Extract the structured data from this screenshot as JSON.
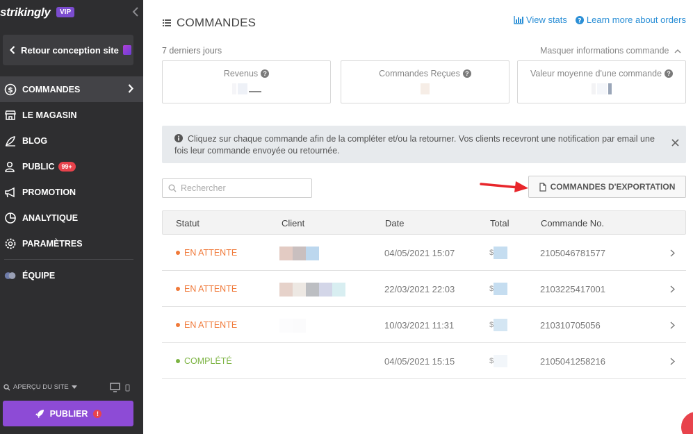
{
  "sidebar": {
    "logo": "strikingly",
    "vip_badge": "VIP",
    "back_label": "Retour conception site",
    "nav": [
      {
        "label": "COMMANDES",
        "icon": "dollar-icon",
        "active": true
      },
      {
        "label": "LE MAGASIN",
        "icon": "store-icon"
      },
      {
        "label": "BLOG",
        "icon": "pen-icon"
      },
      {
        "label": "PUBLIC",
        "icon": "users-icon",
        "badge": "99+"
      },
      {
        "label": "PROMOTION",
        "icon": "megaphone-icon"
      },
      {
        "label": "ANALYTIQUE",
        "icon": "pie-chart-icon"
      },
      {
        "label": "PARAMÈTRES",
        "icon": "gear-icon"
      }
    ],
    "team_label": "ÉQUIPE",
    "preview_label": "APERÇU DU SITE",
    "publish_label": "PUBLIER"
  },
  "header": {
    "title": "COMMANDES",
    "view_stats": "View stats",
    "learn_more": "Learn more about orders"
  },
  "period": "7 derniers jours",
  "hide_info": "Masquer informations commande",
  "stats": [
    {
      "label": "Revenus"
    },
    {
      "label": "Commandes Reçues"
    },
    {
      "label": "Valeur moyenne d'une commande"
    }
  ],
  "notice": "Cliquez sur chaque commande afin de la compléter et/ou la retourner. Vos clients recevront une notification par email une fois leur commande envoyée ou retournée.",
  "search": {
    "placeholder": "Rechercher"
  },
  "export_label": "COMMANDES D'EXPORTATION",
  "table": {
    "headers": [
      "Statut",
      "Client",
      "Date",
      "Total",
      "Commande No."
    ],
    "rows": [
      {
        "status": "EN ATTENTE",
        "date": "04/05/2021 15:07",
        "order_no": "2105046781577"
      },
      {
        "status": "EN ATTENTE",
        "date": "22/03/2021 22:03",
        "order_no": "2103225417001"
      },
      {
        "status": "EN ATTENTE",
        "date": "10/03/2021 11:31",
        "order_no": "210310705056"
      },
      {
        "status": "COMPLÉTÉ",
        "date": "04/05/2021 15:15",
        "order_no": "2105041258216"
      }
    ]
  },
  "colors": {
    "pending": "#f07a3a",
    "completed": "#7cb342",
    "accent": "#8d4bd6",
    "link": "#2b8fd6"
  }
}
